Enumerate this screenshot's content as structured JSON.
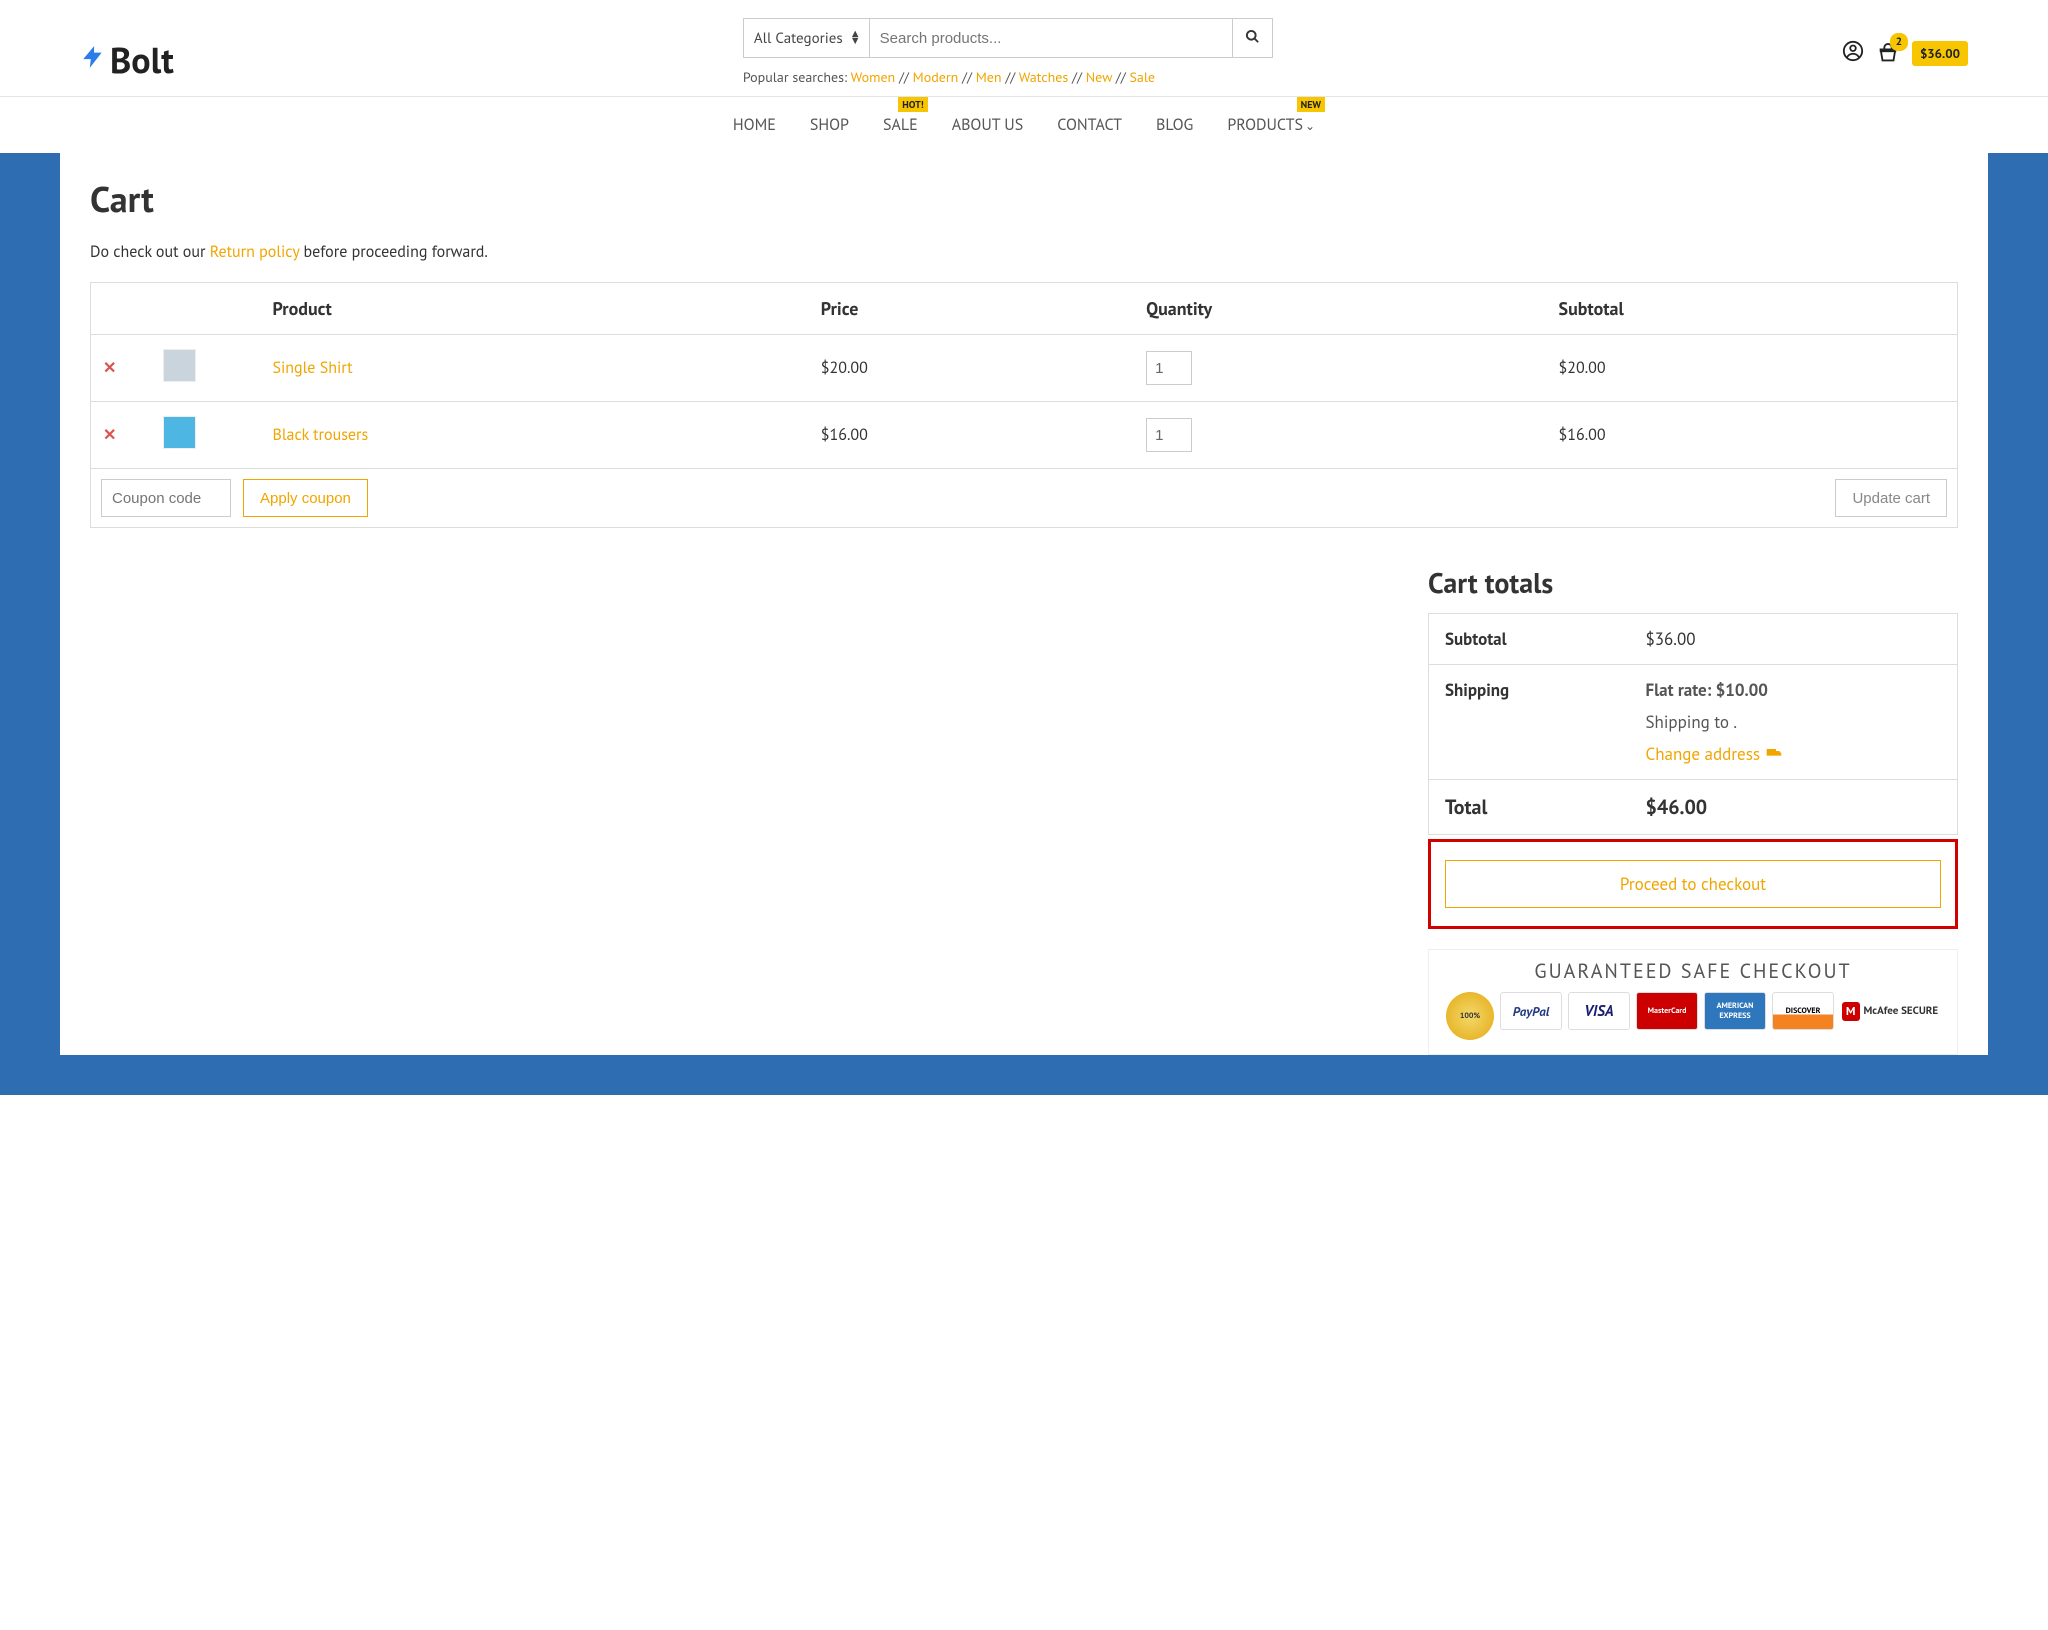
{
  "logo": "Bolt",
  "search": {
    "category": "All Categories",
    "placeholder": "Search products..."
  },
  "popular": {
    "label": "Popular searches:",
    "links": [
      "Women",
      "Modern",
      "Men",
      "Watches",
      "New",
      "Sale"
    ]
  },
  "header": {
    "cart_count": "2",
    "cart_total": "$36.00"
  },
  "nav": {
    "items": [
      "HOME",
      "SHOP",
      "SALE",
      "ABOUT US",
      "CONTACT",
      "BLOG",
      "PRODUCTS"
    ],
    "sale_badge": "HOT!",
    "products_badge": "NEW"
  },
  "page": {
    "title": "Cart",
    "notice_pre": "Do check out our ",
    "notice_link": "Return policy",
    "notice_post": " before proceeding forward."
  },
  "cart": {
    "headers": {
      "product": "Product",
      "price": "Price",
      "quantity": "Quantity",
      "subtotal": "Subtotal"
    },
    "items": [
      {
        "name": "Single Shirt",
        "price": "$20.00",
        "qty": "1",
        "subtotal": "$20.00"
      },
      {
        "name": "Black trousers",
        "price": "$16.00",
        "qty": "1",
        "subtotal": "$16.00"
      }
    ],
    "coupon_placeholder": "Coupon code",
    "apply_coupon": "Apply coupon",
    "update_cart": "Update cart"
  },
  "totals": {
    "title": "Cart totals",
    "subtotal_label": "Subtotal",
    "subtotal": "$36.00",
    "shipping_label": "Shipping",
    "flat_rate": "Flat rate: $10.00",
    "shipping_to": "Shipping to   .",
    "change_address": "Change address",
    "total_label": "Total",
    "total": "$46.00",
    "proceed": "Proceed to checkout",
    "safe_title": "GUARANTEED SAFE CHECKOUT",
    "cards": {
      "seal": "100%",
      "paypal": "PayPal",
      "visa": "VISA",
      "mc": "MasterCard",
      "amex": "AMERICAN EXPRESS",
      "discover": "DISCOVER",
      "mcafee": "McAfee SECURE"
    }
  }
}
